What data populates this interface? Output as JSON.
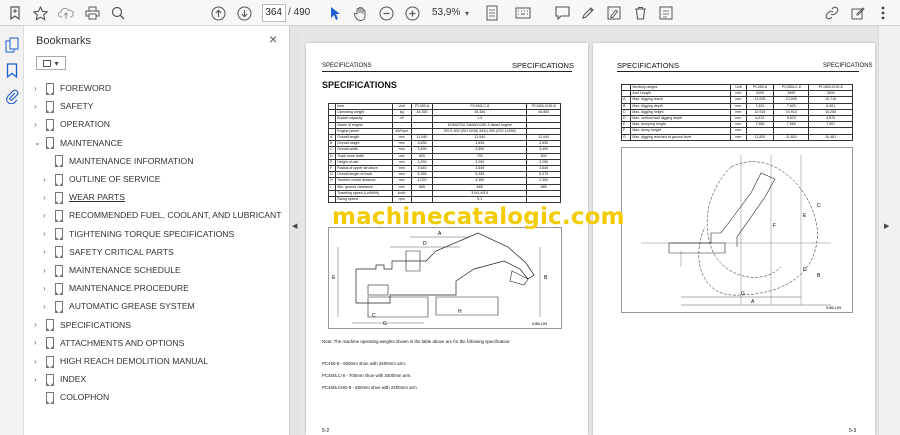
{
  "toolbar": {
    "page_current": "364",
    "page_total": "/ 490",
    "zoom": "53,9%"
  },
  "panel": {
    "title": "Bookmarks",
    "close": "×",
    "options": "▾"
  },
  "bookmarks": [
    {
      "label": "FOREWORD",
      "level": 0,
      "chevron": "›"
    },
    {
      "label": "SAFETY",
      "level": 0,
      "chevron": "›"
    },
    {
      "label": "OPERATION",
      "level": 0,
      "chevron": "›"
    },
    {
      "label": "MAINTENANCE",
      "level": 0,
      "chevron": "⌄"
    },
    {
      "label": "MAINTENANCE INFORMATION",
      "level": 1,
      "chevron": ""
    },
    {
      "label": "OUTLINE OF SERVICE",
      "level": 1,
      "chevron": "›"
    },
    {
      "label": "WEAR PARTS",
      "level": 1,
      "chevron": "›"
    },
    {
      "label": "RECOMMENDED FUEL, COOLANT, AND LUBRICANT",
      "level": 1,
      "chevron": "›"
    },
    {
      "label": "TIGHTENING TORQUE SPECIFICATIONS",
      "level": 1,
      "chevron": "›"
    },
    {
      "label": "SAFETY CRITICAL PARTS",
      "level": 1,
      "chevron": "›"
    },
    {
      "label": "MAINTENANCE SCHEDULE",
      "level": 1,
      "chevron": "›"
    },
    {
      "label": "MAINTENANCE PROCEDURE",
      "level": 1,
      "chevron": "›"
    },
    {
      "label": "AUTOMATIC GREASE SYSTEM",
      "level": 1,
      "chevron": "›"
    },
    {
      "label": "SPECIFICATIONS",
      "level": 0,
      "chevron": "›"
    },
    {
      "label": "ATTACHMENTS AND OPTIONS",
      "level": 0,
      "chevron": "›"
    },
    {
      "label": "HIGH REACH DEMOLITION MANUAL",
      "level": 0,
      "chevron": "›"
    },
    {
      "label": "INDEX",
      "level": 0,
      "chevron": "›"
    },
    {
      "label": "COLOPHON",
      "level": 0,
      "chevron": ""
    }
  ],
  "page_left": {
    "header_small": "SPECIFICATIONS",
    "header_big": "SPECIFICATIONS",
    "title": "SPECIFICATIONS",
    "table": [
      [
        "",
        "Item",
        "Unit",
        "PC450-8",
        "PC450LC-8",
        "PC450LCHD-8"
      ],
      [
        "",
        "Operating weight",
        "kg",
        "44,350",
        "45,450",
        "46,850"
      ],
      [
        "",
        "Bucket capacity",
        "m³",
        "",
        "1.9",
        ""
      ],
      [
        "",
        "Name of engine",
        "-",
        "",
        "KOMATSU SAA6D125E-5 diesel engine",
        ""
      ],
      [
        "",
        "Engine power",
        "kW/rpm",
        "",
        "257/1,900 (ISO 9249) 263/1,900 (ISO 14396)",
        ""
      ],
      [
        "A",
        "Overall length",
        "mm",
        "11,940",
        "11,940",
        "11,940"
      ],
      [
        "B",
        "Overall height",
        "mm",
        "3,635",
        "3,635",
        "3,635"
      ],
      [
        "C",
        "Overall width",
        "mm",
        "3,490",
        "3,590",
        "3,490"
      ],
      [
        "D",
        "Track shoe width",
        "mm",
        "600",
        "700",
        "600"
      ],
      [
        "E",
        "Height of cab",
        "mm",
        "3,250",
        "3,250",
        "3,250"
      ],
      [
        "F",
        "Radius of upper structure",
        "mm",
        "3,645",
        "3,645",
        "3,645"
      ],
      [
        "G",
        "Overall length of track",
        "mm",
        "5,355",
        "5,355",
        "5,375"
      ],
      [
        "H",
        "Tumbler center distance",
        "mm",
        "4,020",
        "4,350",
        "4,350"
      ],
      [
        "I",
        "Min. ground clearance",
        "mm",
        "685",
        "685",
        "685"
      ],
      [
        "",
        "Traveling speed (Lo/Mi/Hi)",
        "km/h",
        "",
        "3.0/4.4/5.5",
        ""
      ],
      [
        "",
        "Swing speed",
        "rpm",
        "",
        "9.1",
        ""
      ]
    ],
    "note1": "Note: The machine operating weights shown in the table above are for the following specification:",
    "note2": "PC450-8 - 600mm shoe with 3400mm arm.",
    "note3": "PC450LC-8 - 700mm shoe with 3400mm arm.",
    "note4": "PC450LCHD-8 - 600mm shoe with 2400mm arm.",
    "page_number": "5-2",
    "figure_code": "5J86-1H9"
  },
  "page_right": {
    "header_big": "SPECIFICATIONS",
    "header_small": "SPECIFICATIONS",
    "table": [
      [
        "",
        "Working ranges",
        "Unit",
        "PC450-8",
        "PC450LC-8",
        "PC450LCHD-8"
      ],
      [
        "",
        "Arm Length",
        "mm",
        "3400",
        "3400",
        "2400"
      ],
      [
        "A",
        "Max. digging reach",
        "mm",
        "12,005",
        "12,005",
        "10,710"
      ],
      [
        "B",
        "Max. digging depth",
        "mm",
        "7,620",
        "7,620",
        "6,401"
      ],
      [
        "C",
        "Max. digging height",
        "mm",
        "10,915",
        "10,915",
        "10,260"
      ],
      [
        "D",
        "Max. vertical wall digging depth",
        "mm",
        "6,870",
        "6,870",
        "4,870"
      ],
      [
        "E",
        "Max. dumping height",
        "mm",
        "7,565",
        "7,565",
        "7,067"
      ],
      [
        "F",
        "Max. dump height",
        "mm",
        "",
        "",
        ""
      ],
      [
        "G",
        "Max. digging reached at ground level",
        "mm",
        "11,820",
        "11,820",
        "10,481"
      ]
    ],
    "page_number": "5-3",
    "figure_code": "5J86-1H9"
  },
  "watermark": "machinecatalogic.com"
}
